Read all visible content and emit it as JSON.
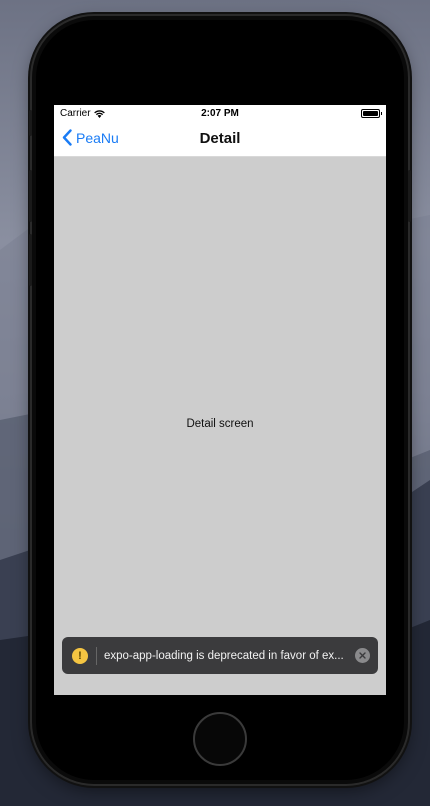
{
  "status_bar": {
    "carrier": "Carrier",
    "time": "2:07 PM"
  },
  "nav": {
    "back_label": "PeaNu",
    "title": "Detail"
  },
  "content": {
    "text": "Detail screen"
  },
  "toast": {
    "icon": "warning-icon",
    "icon_glyph": "!",
    "message": "expo-app-loading is deprecated in favor of ex...",
    "close_icon": "close-icon"
  },
  "colors": {
    "accent": "#1a7cf5",
    "screen_bg": "#cdcdcd",
    "toast_bg": "#3b3b3d",
    "warning": "#f5c542"
  }
}
